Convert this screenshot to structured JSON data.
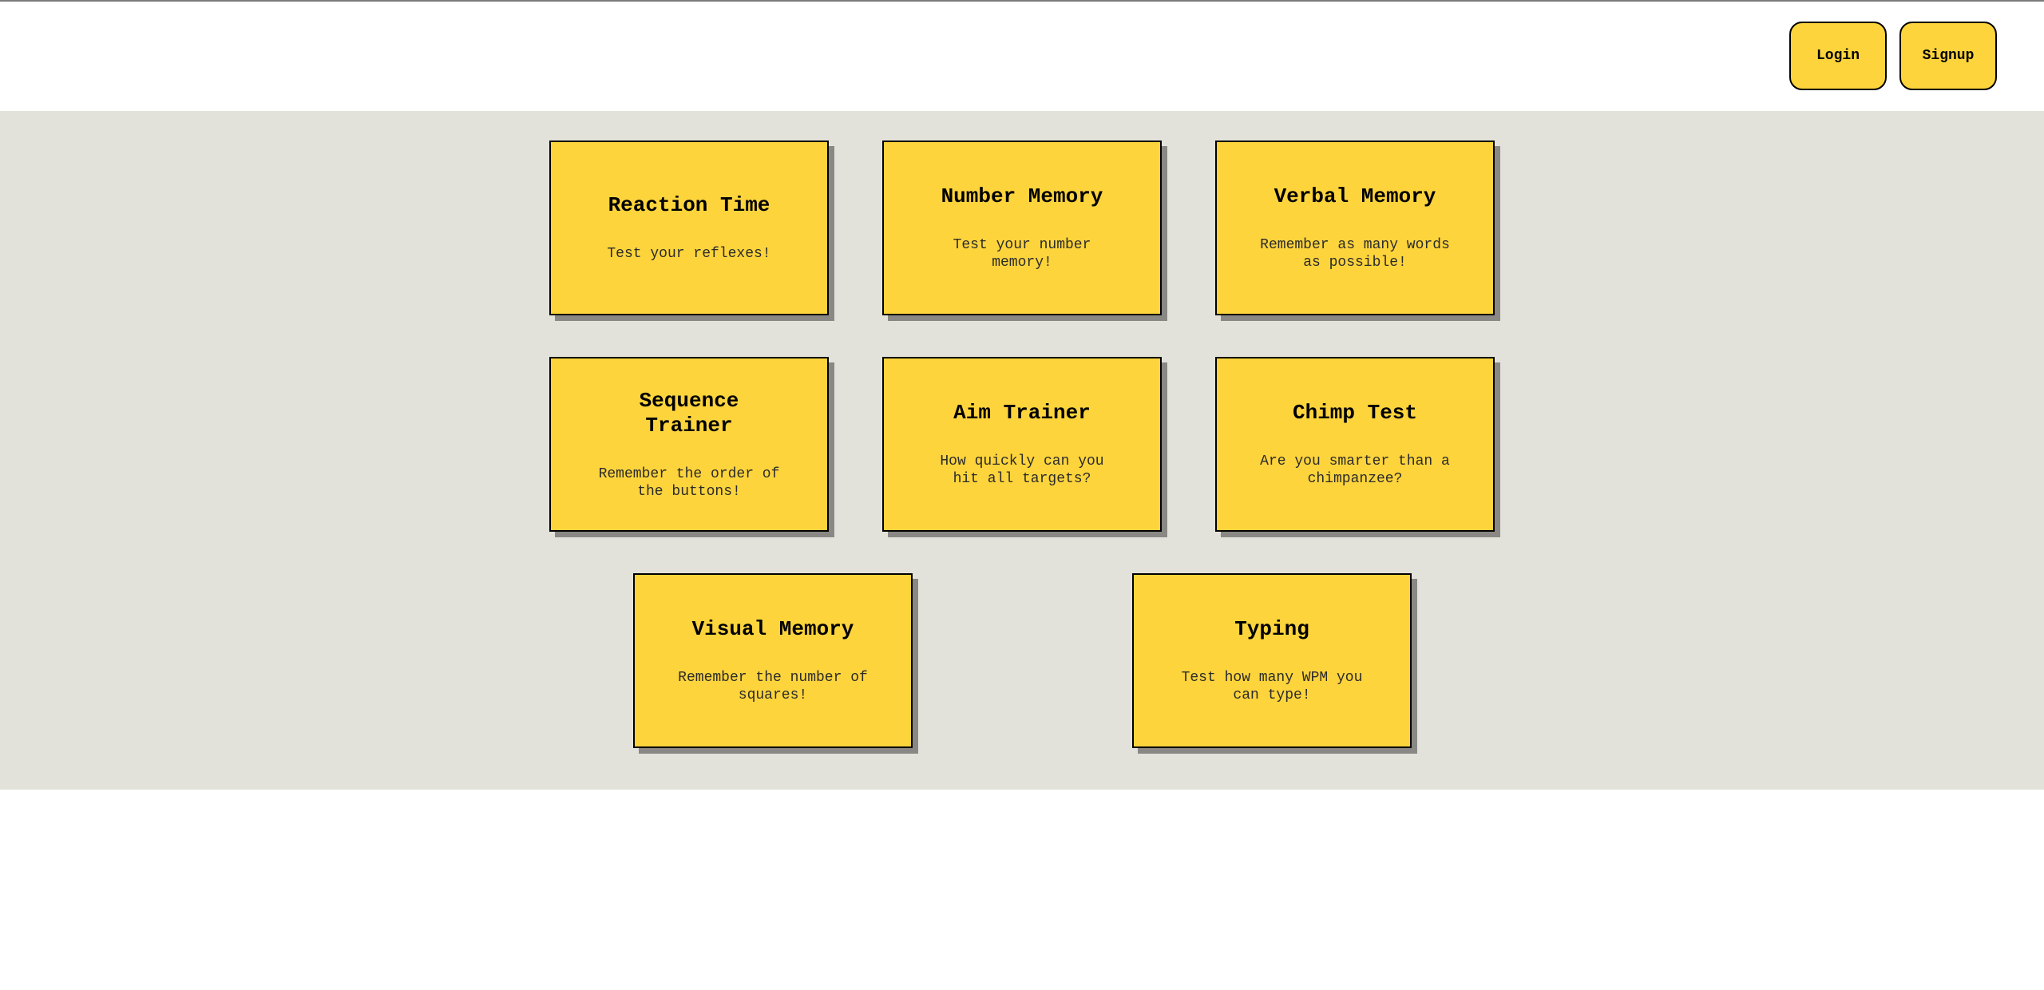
{
  "header": {
    "login_label": "Login",
    "signup_label": "Signup"
  },
  "cards": [
    {
      "title": "Reaction Time",
      "description": "Test your reflexes!"
    },
    {
      "title": "Number Memory",
      "description": "Test your number memory!"
    },
    {
      "title": "Verbal Memory",
      "description": "Remember as many words as possible!"
    },
    {
      "title": "Sequence Trainer",
      "description": "Remember the order of the buttons!"
    },
    {
      "title": "Aim Trainer",
      "description": "How quickly can you hit all targets?"
    },
    {
      "title": "Chimp Test",
      "description": "Are you smarter than a chimpanzee?"
    },
    {
      "title": "Visual Memory",
      "description": "Remember the number of squares!"
    },
    {
      "title": "Typing",
      "description": "Test how many WPM you can type!"
    }
  ],
  "colors": {
    "accent": "#fdd43c",
    "background": "#e3e2da",
    "shadow": "#8a8884"
  }
}
